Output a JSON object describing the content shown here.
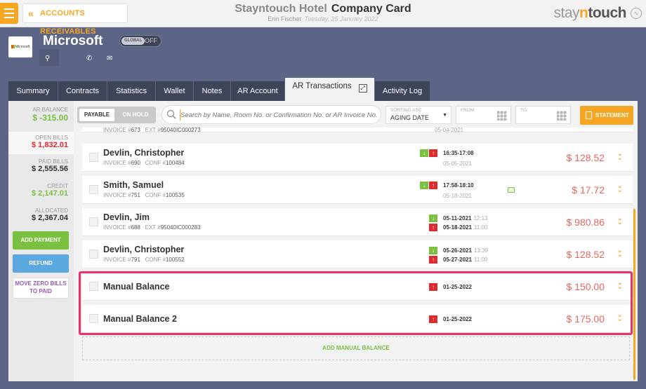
{
  "topbar": {
    "back_label": "ACCOUNTS RECEIVABLES",
    "hotel_name": "Stayntouch Hotel",
    "page_name": "Company Card",
    "user": "Erin Fischer",
    "date": "Tuesday, 25 January 2022",
    "brand_a": "stay",
    "brand_n": "n",
    "brand_b": "touch"
  },
  "header": {
    "company_name": "Microsoft",
    "logo_text": "Microsoft",
    "global_label": "GLOBAL",
    "global_state": "OFF"
  },
  "tabs": [
    {
      "label": "Summary"
    },
    {
      "label": "Contracts"
    },
    {
      "label": "Statistics"
    },
    {
      "label": "Wallet"
    },
    {
      "label": "Notes"
    },
    {
      "label": "AR Account"
    },
    {
      "label": "AR Transactions"
    },
    {
      "label": "Activity Log"
    }
  ],
  "summary": {
    "ar_balance_label": "AR BALANCE",
    "ar_balance": "$ -315.00",
    "open_bills_label": "OPEN BILLS",
    "open_bills": "$ 1,832.01",
    "paid_bills_label": "PAID BILLS",
    "paid_bills": "$ 2,555.56",
    "credit_label": "CREDIT",
    "credit": "$ 2,147.01",
    "allocated_label": "ALLOCATED",
    "allocated": "$ 2,367.04"
  },
  "actions": {
    "add_payment": "ADD PAYMENT",
    "refund": "REFUND",
    "move_zero": "MOVE ZERO BILLS TO PAID",
    "statement": "STATEMENT",
    "add_manual_balance": "ADD MANUAL BALANCE"
  },
  "filters": {
    "payable": "PAYABLE",
    "on_hold": "ON HOLD",
    "search_placeholder": "Search by Name, Room No. or Confirmation No. or AR Invoice No.",
    "sorting_label": "SORTING ASC",
    "sorting_value": "AGING DATE",
    "from_label": "FROM",
    "to_label": "TO"
  },
  "rows": [
    {
      "name": "",
      "invoice_label": "INVOICE #",
      "invoice": "673",
      "ref_label": "EXT #",
      "ref": "95040IC000273",
      "date1": "",
      "date2": "05-04-2021",
      "amount": ""
    },
    {
      "name": "Devlin, Christopher",
      "invoice_label": "INVOICE #",
      "invoice": "690",
      "ref_label": "CONF #",
      "ref": "100484",
      "date1": "16:35-17:08",
      "date2": "05-05-2021",
      "amount": "$ 128.52"
    },
    {
      "name": "Smith, Samuel",
      "invoice_label": "INVOICE #",
      "invoice": "751",
      "ref_label": "CONF #",
      "ref": "100535",
      "date1": "17:58-18:10",
      "date2": "05-18-2021",
      "amount": "$ 17.72"
    },
    {
      "name": "Devlin, Jim",
      "invoice_label": "INVOICE #",
      "invoice": "688",
      "ref_label": "EXT #",
      "ref": "95040IC000283",
      "date1": "05-11-2021",
      "time1": "12:13",
      "date2": "05-18-2021",
      "time2": "11:00",
      "amount": "$ 980.86"
    },
    {
      "name": "Devlin, Christopher",
      "invoice_label": "INVOICE #",
      "invoice": "791",
      "ref_label": "CONF #",
      "ref": "100552",
      "date1": "05-26-2021",
      "time1": "13:39",
      "date2": "05-27-2021",
      "time2": "11:00",
      "amount": "$ 128.52"
    },
    {
      "name": "Manual Balance",
      "date1": "01-25-2022",
      "amount": "$ 150.00"
    },
    {
      "name": "Manual Balance 2",
      "date1": "01-25-2022",
      "amount": "$ 175.00"
    }
  ],
  "colors": {
    "accent": "#f5a623",
    "header_bg": "#5d6586",
    "tab_bg": "#3f4559",
    "negative": "#e0282f",
    "positive": "#7ac141",
    "highlight": "#ee2f68"
  }
}
